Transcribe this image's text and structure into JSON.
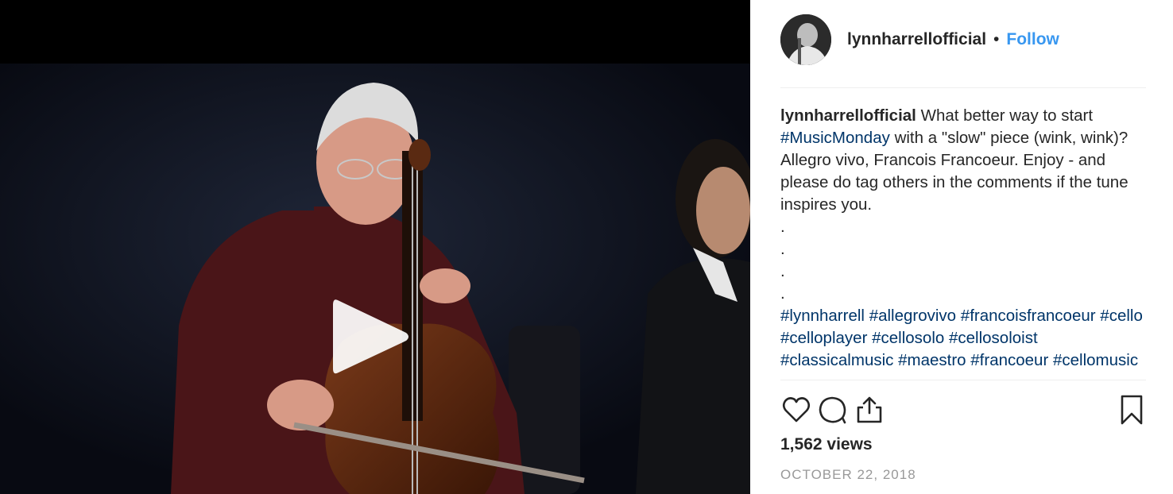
{
  "post": {
    "username": "lynnharrellofficial",
    "separator": "•",
    "follow_label": "Follow",
    "caption_text": "What better way to start",
    "caption_rest_1": "with a \"slow\" piece (wink, wink)? Allegro vivo, Francois Francoeur. Enjoy - and please do tag others in the comments if the tune inspires you.",
    "hashtags": {
      "music_monday": "#MusicMonday",
      "lynnharrell": "#lynnharrell",
      "allegrovivo": "#allegrovivo",
      "francoisfrancoeur": "#francoisfrancoeur",
      "cello": "#cello",
      "celloplayer": "#celloplayer",
      "cellosolo": "#cellosolo",
      "cellosoloist": "#cellosoloist",
      "classicalmusic": "#classicalmusic",
      "maestro": "#maestro",
      "francoeur": "#francoeur",
      "cellomusic": "#cellomusic"
    },
    "dots": [
      ".",
      ".",
      ".",
      "."
    ],
    "views": "1,562 views",
    "date": "OCTOBER 22, 2018"
  },
  "colors": {
    "link": "#3897f0",
    "hashtag": "#003569",
    "text": "#262626",
    "muted": "#999999"
  },
  "icons": {
    "play": "play-icon",
    "like": "heart-icon",
    "comment": "comment-icon",
    "share": "share-icon",
    "save": "bookmark-icon"
  }
}
